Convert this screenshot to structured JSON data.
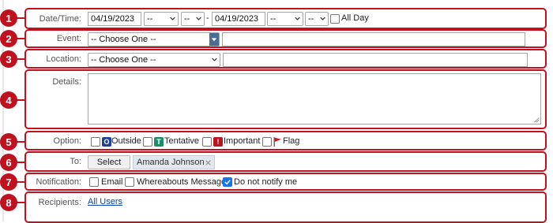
{
  "badges": [
    "1",
    "2",
    "3",
    "4",
    "5",
    "6",
    "7",
    "8"
  ],
  "datetime": {
    "label": "Date/Time:",
    "start_date": "04/19/2023",
    "start_hour": "--",
    "start_min": "--",
    "separator": "-",
    "end_date": "04/19/2023",
    "end_hour": "--",
    "end_min": "--",
    "all_day_label": "All Day"
  },
  "event": {
    "label": "Event:",
    "select_value": "-- Choose One --",
    "text_value": ""
  },
  "location": {
    "label": "Location:",
    "select_value": "-- Choose One --",
    "text_value": ""
  },
  "details": {
    "label": "Details:",
    "value": ""
  },
  "option": {
    "label": "Option:",
    "items": [
      {
        "icon": "O",
        "text": "Outside",
        "icon_color": "#1f3f9a"
      },
      {
        "icon": "T",
        "text": "Tentative",
        "icon_color": "#1c8c6a"
      },
      {
        "icon": "!",
        "text": "Important",
        "icon_color": "#c0111f"
      },
      {
        "icon": "flag",
        "text": "Flag",
        "icon_color": "#d2161f"
      }
    ]
  },
  "to": {
    "label": "To:",
    "select_button": "Select",
    "recipient": "Amanda Johnson"
  },
  "notification": {
    "label": "Notification:",
    "email": "Email",
    "whereabouts": "Whereabouts Message",
    "do_not_notify": "Do not notify me",
    "do_not_notify_checked": true
  },
  "recipients": {
    "label": "Recipients:",
    "link": "All Users"
  },
  "colors": {
    "accent": "#c0111f",
    "link": "#0645ad",
    "checkbox_on": "#1a73e8"
  }
}
